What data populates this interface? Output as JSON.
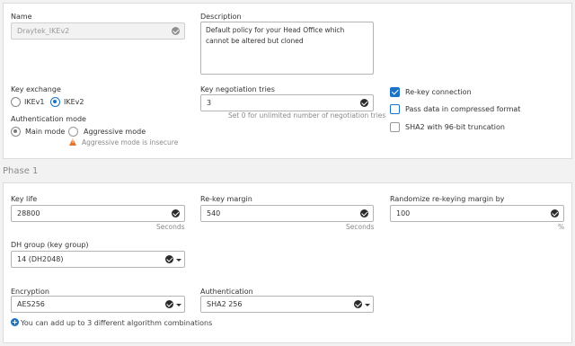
{
  "general": {
    "name_label": "Name",
    "name_value": "Draytek_IKEv2",
    "description_label": "Description",
    "description_value": "Default policy for your Head Office which cannot be altered but cloned",
    "key_exchange_label": "Key exchange",
    "ikev1_label": "IKEv1",
    "ikev2_label": "IKEv2",
    "key_exchange_selected": "IKEv2",
    "auth_mode_label": "Authentication mode",
    "main_mode_label": "Main mode",
    "aggressive_mode_label": "Aggressive mode",
    "aggressive_warning": "Aggressive mode is insecure",
    "key_negotiation_label": "Key negotiation tries",
    "key_negotiation_value": "3",
    "key_negotiation_hint": "Set 0 for unlimited number of negotiation tries",
    "rekey_connection_label": "Re-key connection",
    "rekey_connection_checked": true,
    "pass_data_label": "Pass data in compressed format",
    "pass_data_checked": false,
    "sha2_label": "SHA2 with 96-bit truncation",
    "sha2_checked": false
  },
  "phase1": {
    "title": "Phase 1",
    "key_life_label": "Key life",
    "key_life_value": "28800",
    "key_life_unit": "Seconds",
    "rekey_margin_label": "Re-key margin",
    "rekey_margin_value": "540",
    "rekey_margin_unit": "Seconds",
    "randomize_label": "Randomize re-keying margin by",
    "randomize_value": "100",
    "randomize_unit": "%",
    "dh_group_label": "DH group (key group)",
    "dh_group_value": "14 (DH2048)",
    "encryption_label": "Encryption",
    "encryption_value": "AES256",
    "authentication_label": "Authentication",
    "authentication_value": "SHA2 256",
    "add_combination_text": "You can add up to 3 different algorithm combinations"
  },
  "colors": {
    "accent": "#1a73c8",
    "warning": "#e8742a"
  }
}
